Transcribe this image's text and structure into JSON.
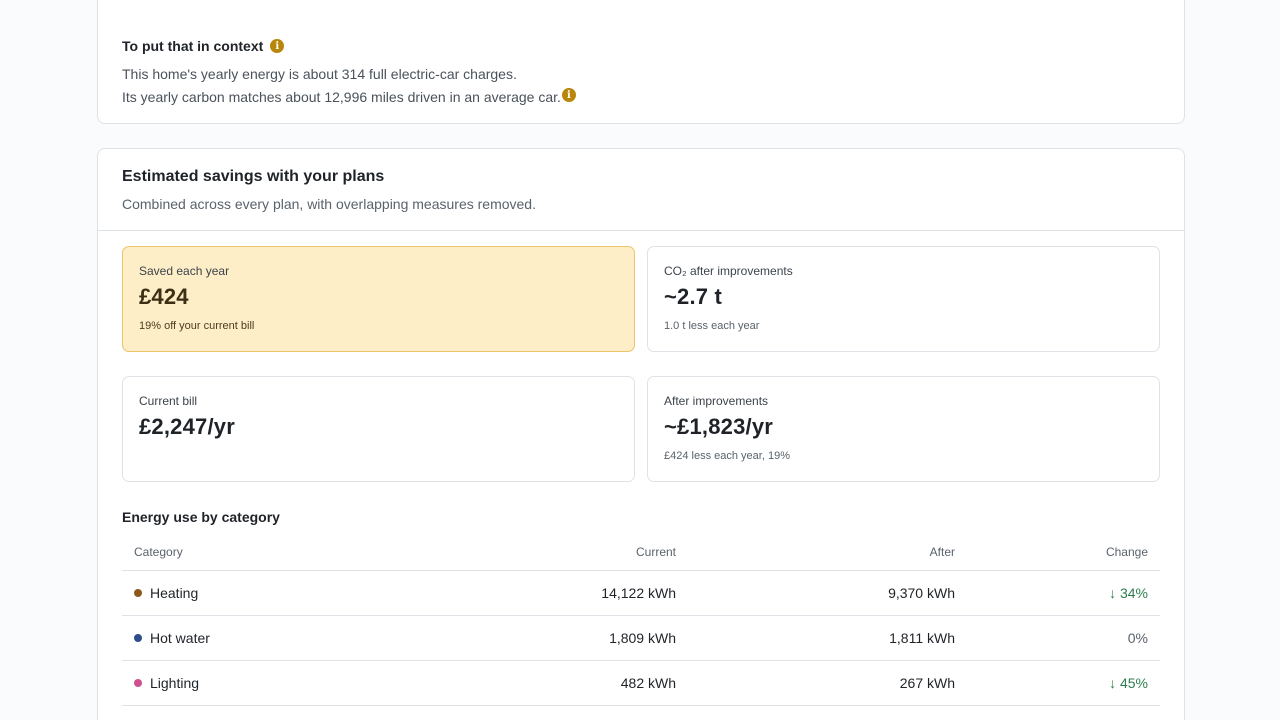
{
  "context": {
    "title": "To put that in context",
    "line1": "This home's yearly energy is about 314 full electric-car charges.",
    "line2": "Its yearly carbon matches about 12,996 miles driven in an average car."
  },
  "savings": {
    "title": "Estimated savings with your plans",
    "subtitle": "Combined across every plan, with overlapping measures removed.",
    "stats": {
      "saved": {
        "label": "Saved each year",
        "value": "£424",
        "note": "19% off your current bill"
      },
      "co2": {
        "label": "CO₂ after improvements",
        "value": "~2.7 t",
        "note": "1.0 t less each year"
      },
      "current": {
        "label": "Current bill",
        "value": "£2,247/yr"
      },
      "after": {
        "label": "After improvements",
        "value": "~£1,823/yr",
        "note": "£424 less each year, 19%"
      }
    }
  },
  "category_table": {
    "title": "Energy use by category",
    "headers": {
      "category": "Category",
      "current": "Current",
      "after": "After",
      "change": "Change"
    },
    "rows": [
      {
        "name": "Heating",
        "dot_color": "#8b5a1a",
        "current": "14,122 kWh",
        "after": "9,370 kWh",
        "change": "↓ 34%",
        "trend": "down"
      },
      {
        "name": "Hot water",
        "dot_color": "#2c4f8a",
        "current": "1,809 kWh",
        "after": "1,811 kWh",
        "change": "0%",
        "trend": "flat"
      },
      {
        "name": "Lighting",
        "dot_color": "#d0508e",
        "current": "482 kWh",
        "after": "267 kWh",
        "change": "↓ 45%",
        "trend": "down"
      }
    ]
  },
  "icons": {
    "info": "info-icon"
  },
  "colors": {
    "accent": "#b8860b",
    "highlight_bg": "#fdeec8",
    "positive": "#2e7d4f"
  }
}
